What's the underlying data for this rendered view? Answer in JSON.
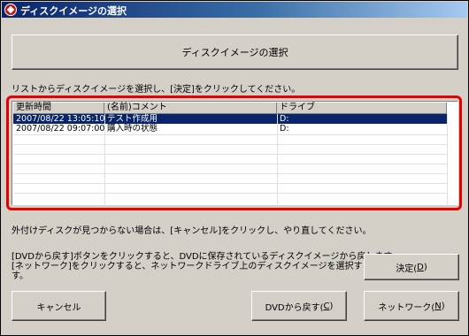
{
  "window": {
    "title": "ディスクイメージの選択"
  },
  "header_box": {
    "label": "ディスクイメージの選択"
  },
  "instruction": "リストからディスクイメージを選択し、[決定]をクリックしてください。",
  "list": {
    "columns": [
      "更新時間",
      "(名前)コメント",
      "ドライブ"
    ],
    "rows": [
      {
        "time": "2007/08/22 13:05:10",
        "comment": "テスト作成用",
        "drive": "D:",
        "selected": true
      },
      {
        "time": "2007/08/22 09:07:00",
        "comment": "購入時の状態",
        "drive": "D:",
        "selected": false
      }
    ]
  },
  "note_external": "外付けディスクが見つからない場合は、[キャンセル]をクリックし、やり直してください。",
  "note_dvd": "[DVDから戻す]ボタンをクリックすると、DVDに保存されているディスクイメージから戻します。",
  "note_network_1": "[ネットワーク]をクリックすると、ネットワークドライブ上のディスクイメージを選択することができま",
  "note_network_2": "す。",
  "buttons": {
    "decide": "決定(",
    "decide_key": "D",
    "cancel": "キャンセル",
    "dvd": "DVDから戻す(",
    "dvd_key": "C",
    "network": "ネットワーク(",
    "network_key": "N",
    "close_paren": ")"
  },
  "colors": {
    "title_bar": "#0a246a",
    "highlight_frame": "#e60000",
    "selection": "#0a246a",
    "face": "#d4d0c8"
  }
}
